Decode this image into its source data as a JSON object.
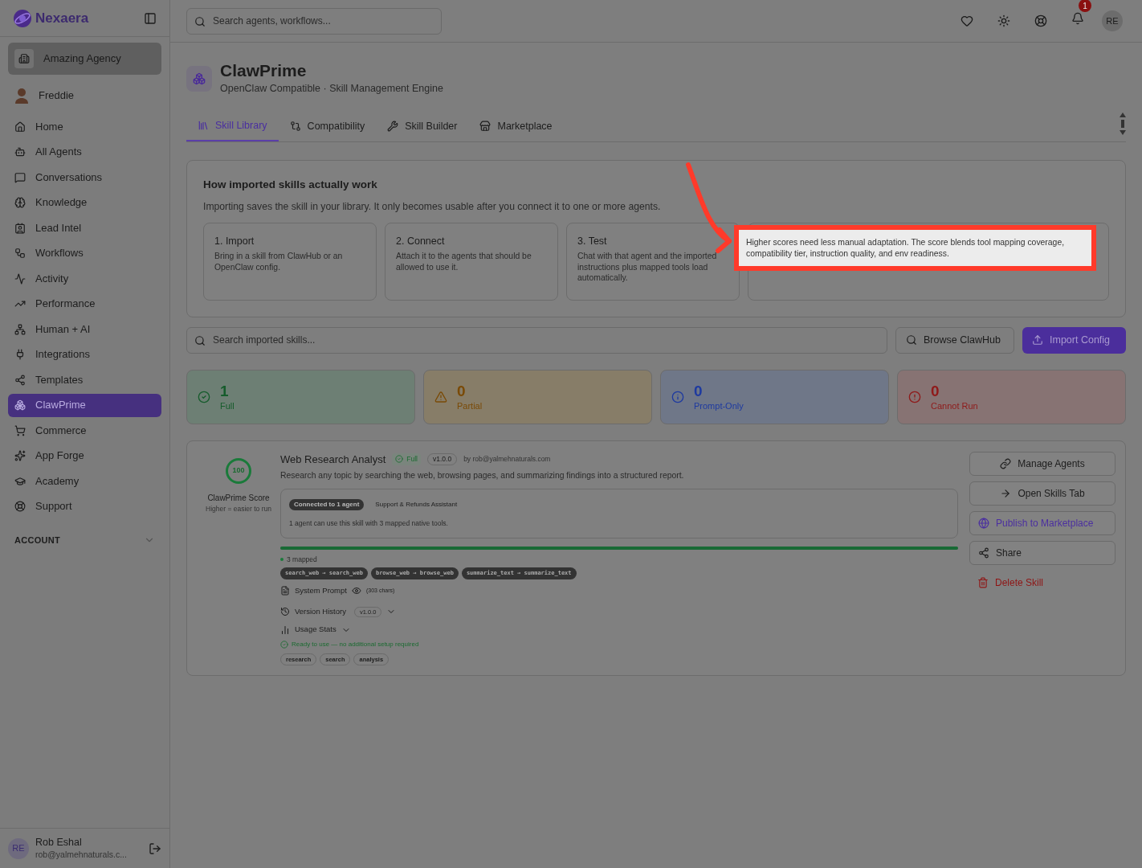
{
  "brand": {
    "name": "Nexaera"
  },
  "workspace": {
    "name": "Amazing Agency"
  },
  "persona": {
    "name": "Freddie"
  },
  "nav": [
    {
      "label": "Home",
      "selected": false
    },
    {
      "label": "All Agents",
      "selected": false
    },
    {
      "label": "Conversations",
      "selected": false
    },
    {
      "label": "Knowledge",
      "selected": false
    },
    {
      "label": "Lead Intel",
      "selected": false
    },
    {
      "label": "Workflows",
      "selected": false
    },
    {
      "label": "Activity",
      "selected": false
    },
    {
      "label": "Performance",
      "selected": false
    },
    {
      "label": "Human + AI",
      "selected": false
    },
    {
      "label": "Integrations",
      "selected": false
    },
    {
      "label": "Templates",
      "selected": false
    },
    {
      "label": "ClawPrime",
      "selected": true
    },
    {
      "label": "Commerce",
      "selected": false
    },
    {
      "label": "App Forge",
      "selected": false
    },
    {
      "label": "Academy",
      "selected": false
    },
    {
      "label": "Support",
      "selected": false
    }
  ],
  "account_section": {
    "label": "ACCOUNT",
    "expanded": false
  },
  "user": {
    "initials": "RE",
    "name": "Rob Eshal",
    "email": "rob@yalmehnaturals.c..."
  },
  "top_search": {
    "placeholder": "Search agents, workflows..."
  },
  "notifications": {
    "count": "1"
  },
  "top_avatar": {
    "initials": "RE"
  },
  "page": {
    "title": "ClawPrime",
    "subtitle": "OpenClaw Compatible · Skill Management Engine"
  },
  "tabs": [
    {
      "label": "Skill Library",
      "selected": true
    },
    {
      "label": "Compatibility",
      "selected": false
    },
    {
      "label": "Skill Builder",
      "selected": false
    },
    {
      "label": "Marketplace",
      "selected": false
    }
  ],
  "how_it_works": {
    "title": "How imported skills actually work",
    "text": "Importing saves the skill in your library. It only becomes usable after you connect it to one or more agents.",
    "steps": [
      {
        "title": "1. Import",
        "text": "Bring in a skill from ClawHub or an OpenClaw config."
      },
      {
        "title": "2. Connect",
        "text": "Attach it to the agents that should be allowed to use it."
      },
      {
        "title": "3. Test",
        "text": "Chat with that agent and the imported instructions plus mapped tools load automatically."
      }
    ]
  },
  "tooltip": {
    "text": "Higher scores need less manual adaptation. The score blends tool mapping coverage, compatibility tier, instruction quality, and env readiness."
  },
  "skill_search": {
    "placeholder": "Search imported skills..."
  },
  "actions": [
    {
      "label": "Browse ClawHub",
      "kind": "outline"
    },
    {
      "label": "Import Config",
      "kind": "primary"
    }
  ],
  "stats": [
    {
      "value": "1",
      "label": "Full",
      "kind": "full"
    },
    {
      "value": "0",
      "label": "Partial",
      "kind": "partial"
    },
    {
      "value": "0",
      "label": "Prompt-Only",
      "kind": "prompt"
    },
    {
      "value": "0",
      "label": "Cannot Run",
      "kind": "cannot"
    }
  ],
  "skill": {
    "score": "100",
    "score_label": "ClawPrime Score",
    "score_hint": "Higher = easier to run",
    "name": "Web Research Analyst",
    "tier": "Full",
    "version": "v1.0.0",
    "author": "by rob@yalmehnaturals.com",
    "description": "Research any topic by searching the web, browsing pages, and summarizing findings into a structured report.",
    "connected_badge": "Connected to 1 agent",
    "agent": "Support & Refunds Assistant",
    "usage_note": "1 agent can use this skill with 3 mapped native tools.",
    "mapping_bar": {
      "level": 1
    },
    "mapped_label": "3 mapped",
    "mappings": [
      "search_web → search_web",
      "browse_web → browse_web",
      "summarize_text → summarize_text"
    ],
    "system_prompt": "System Prompt",
    "prompt_chars": "(303 chars)",
    "version_history": "Version History",
    "version_badge": "v1.0.0",
    "usage_stats": "Usage Stats",
    "ready": "Ready to use — no additional setup required",
    "tags": [
      "research",
      "search",
      "analysis"
    ],
    "buttons": [
      {
        "label": "Manage Agents",
        "kind": "outline"
      },
      {
        "label": "Open Skills Tab",
        "kind": "outline"
      },
      {
        "label": "Publish to Marketplace",
        "kind": "accent"
      },
      {
        "label": "Share",
        "kind": "plain"
      },
      {
        "label": "Delete Skill",
        "kind": "danger"
      }
    ]
  }
}
